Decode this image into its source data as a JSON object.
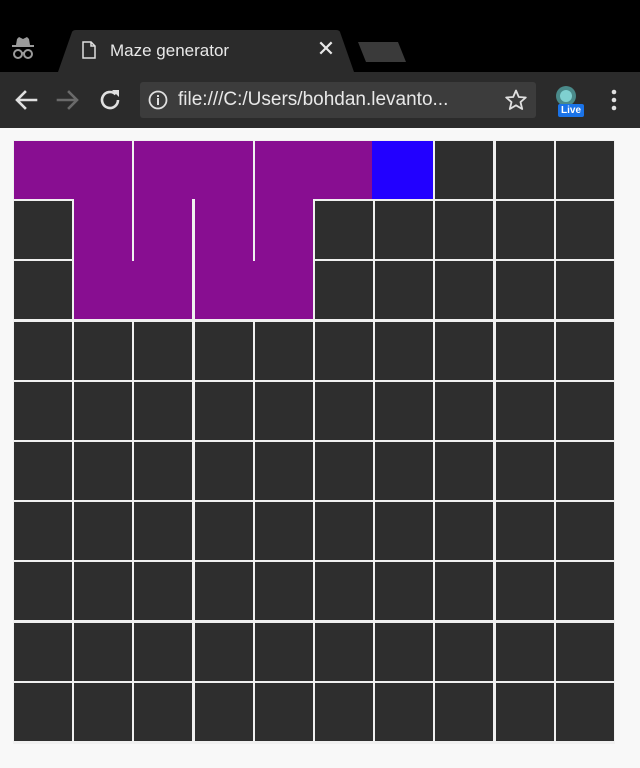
{
  "tab": {
    "title": "Maze generator",
    "close_glyph": "✕"
  },
  "omnibox": {
    "url": "file:///C:/Users/bohdan.levanto..."
  },
  "extension": {
    "badge": "Live"
  },
  "icons": {
    "incognito": "incognito-icon",
    "page": "page-icon",
    "close": "close-icon",
    "back": "back-arrow-icon",
    "forward": "forward-arrow-icon",
    "reload": "reload-icon",
    "info": "info-icon",
    "star": "star-icon",
    "menu": "kebab-menu-icon"
  },
  "maze": {
    "rows": 10,
    "cols": 10,
    "colors": {
      "unvisited": "#2e2e2e",
      "visited": "#880e91",
      "current": "#2200ff",
      "wall": "#f0f0f0"
    },
    "visited_cells": [
      [
        0,
        0
      ],
      [
        0,
        1
      ],
      [
        0,
        2
      ],
      [
        0,
        3
      ],
      [
        0,
        4
      ],
      [
        0,
        5
      ],
      [
        1,
        1
      ],
      [
        1,
        2
      ],
      [
        1,
        3
      ],
      [
        1,
        4
      ],
      [
        2,
        1
      ],
      [
        2,
        2
      ],
      [
        2,
        3
      ],
      [
        2,
        4
      ]
    ],
    "current_cell": [
      0,
      6
    ]
  }
}
